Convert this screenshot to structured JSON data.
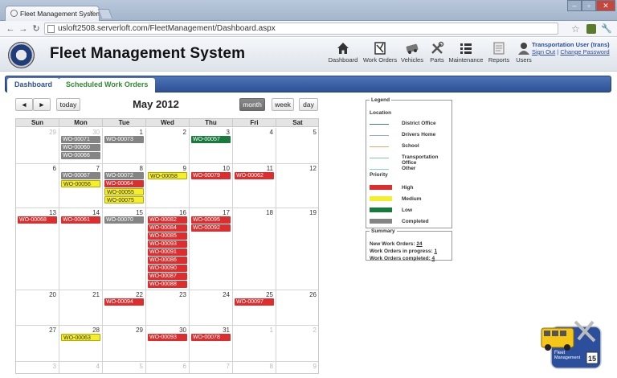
{
  "browser": {
    "tab_title": "Fleet Management System",
    "url": "usloft2508.serverloft.com/FleetManagement/Dashboard.aspx",
    "tab_close": "×"
  },
  "header": {
    "title": "Fleet Management System",
    "nav": [
      {
        "label": "Dashboard",
        "icon": "home-icon"
      },
      {
        "label": "Work Orders",
        "icon": "work-order-icon"
      },
      {
        "label": "Vehicles",
        "icon": "vehicle-icon"
      },
      {
        "label": "Parts",
        "icon": "parts-icon"
      },
      {
        "label": "Maintenance",
        "icon": "maintenance-icon"
      },
      {
        "label": "Reports",
        "icon": "reports-icon"
      },
      {
        "label": "Users",
        "icon": "users-icon"
      }
    ],
    "user": {
      "name": "Transportation User (trans)",
      "signout": "Sign Out",
      "separator": "|",
      "change_password": "Change Password"
    }
  },
  "tabs": [
    {
      "label": "Dashboard",
      "active": true
    },
    {
      "label": "Scheduled Work Orders",
      "active": false
    }
  ],
  "calendar": {
    "title": "May 2012",
    "prev": "◄",
    "next": "►",
    "today": "today",
    "views": [
      {
        "label": "month",
        "active": true
      },
      {
        "label": "week",
        "active": false
      },
      {
        "label": "day",
        "active": false
      }
    ],
    "days": [
      "Sun",
      "Mon",
      "Tue",
      "Wed",
      "Thu",
      "Fri",
      "Sat"
    ],
    "weeks": [
      [
        {
          "d": "29",
          "o": true
        },
        {
          "d": "30",
          "o": true
        },
        {
          "d": "1"
        },
        {
          "d": "2"
        },
        {
          "d": "3"
        },
        {
          "d": "4"
        },
        {
          "d": "5"
        }
      ],
      [
        {
          "d": "6"
        },
        {
          "d": "7"
        },
        {
          "d": "8"
        },
        {
          "d": "9"
        },
        {
          "d": "10"
        },
        {
          "d": "11"
        },
        {
          "d": "12"
        }
      ],
      [
        {
          "d": "13"
        },
        {
          "d": "14"
        },
        {
          "d": "15"
        },
        {
          "d": "16"
        },
        {
          "d": "17"
        },
        {
          "d": "18"
        },
        {
          "d": "19"
        }
      ],
      [
        {
          "d": "20"
        },
        {
          "d": "21"
        },
        {
          "d": "22"
        },
        {
          "d": "23"
        },
        {
          "d": "24"
        },
        {
          "d": "25"
        },
        {
          "d": "26"
        }
      ],
      [
        {
          "d": "27"
        },
        {
          "d": "28"
        },
        {
          "d": "29"
        },
        {
          "d": "30"
        },
        {
          "d": "31"
        },
        {
          "d": "1",
          "o": true
        },
        {
          "d": "2",
          "o": true
        }
      ],
      [
        {
          "d": "3",
          "o": true
        },
        {
          "d": "4",
          "o": true
        },
        {
          "d": "5",
          "o": true
        },
        {
          "d": "6",
          "o": true
        },
        {
          "d": "7",
          "o": true
        },
        {
          "d": "8",
          "o": true
        },
        {
          "d": "9",
          "o": true
        }
      ]
    ],
    "events": [
      {
        "w": 0,
        "d": 1,
        "label": "WO-00071",
        "p": "completed"
      },
      {
        "w": 0,
        "d": 1,
        "label": "WO-00060",
        "p": "completed"
      },
      {
        "w": 0,
        "d": 1,
        "label": "WO-00066",
        "p": "completed"
      },
      {
        "w": 0,
        "d": 2,
        "label": "WO-00073",
        "p": "completed"
      },
      {
        "w": 0,
        "d": 4,
        "label": "WO-00057",
        "p": "low"
      },
      {
        "w": 1,
        "d": 1,
        "label": "WO-00067",
        "p": "completed"
      },
      {
        "w": 1,
        "d": 1,
        "label": "WO-00056",
        "p": "medium"
      },
      {
        "w": 1,
        "d": 2,
        "label": "WO-00072",
        "p": "completed"
      },
      {
        "w": 1,
        "d": 2,
        "label": "WO-00064",
        "p": "high"
      },
      {
        "w": 1,
        "d": 2,
        "label": "WO-00055",
        "p": "medium"
      },
      {
        "w": 1,
        "d": 2,
        "label": "WO-00075",
        "p": "medium"
      },
      {
        "w": 1,
        "d": 3,
        "label": "WO-00058",
        "p": "medium"
      },
      {
        "w": 1,
        "d": 4,
        "label": "WO-00079",
        "p": "high"
      },
      {
        "w": 1,
        "d": 5,
        "label": "WO-00062",
        "p": "high"
      },
      {
        "w": 2,
        "d": 0,
        "label": "WO-00068",
        "p": "high"
      },
      {
        "w": 2,
        "d": 1,
        "label": "WO-00061",
        "p": "high"
      },
      {
        "w": 2,
        "d": 2,
        "label": "WO-00070",
        "p": "completed"
      },
      {
        "w": 2,
        "d": 3,
        "label": "WO-00082",
        "p": "high"
      },
      {
        "w": 2,
        "d": 3,
        "label": "WO-00084",
        "p": "high"
      },
      {
        "w": 2,
        "d": 3,
        "label": "WO-00085",
        "p": "high"
      },
      {
        "w": 2,
        "d": 3,
        "label": "WO-00093",
        "p": "high"
      },
      {
        "w": 2,
        "d": 3,
        "label": "WO-00091",
        "p": "high"
      },
      {
        "w": 2,
        "d": 3,
        "label": "WO-00086",
        "p": "high"
      },
      {
        "w": 2,
        "d": 3,
        "label": "WO-00090",
        "p": "high"
      },
      {
        "w": 2,
        "d": 3,
        "label": "WO-00087",
        "p": "high"
      },
      {
        "w": 2,
        "d": 3,
        "label": "WO-00088",
        "p": "high"
      },
      {
        "w": 2,
        "d": 4,
        "label": "WO-00095",
        "p": "high"
      },
      {
        "w": 2,
        "d": 4,
        "label": "WO-00092",
        "p": "high"
      },
      {
        "w": 3,
        "d": 2,
        "label": "WO-00094",
        "p": "high"
      },
      {
        "w": 3,
        "d": 5,
        "label": "WO-00097",
        "p": "high"
      },
      {
        "w": 4,
        "d": 1,
        "label": "WO-00063",
        "p": "medium"
      },
      {
        "w": 4,
        "d": 3,
        "label": "WO-00093",
        "p": "high"
      },
      {
        "w": 4,
        "d": 4,
        "label": "WO-00078",
        "p": "high"
      }
    ]
  },
  "legend": {
    "title": "Legend",
    "location_title": "Location",
    "locations": [
      {
        "label": "District Office",
        "color": "#4a6fb5"
      },
      {
        "label": "Drivers Home",
        "color": "#9aa8e0"
      },
      {
        "label": "School",
        "color": "#f0a868"
      },
      {
        "label": "Transportation Office",
        "color": "#88c8a0"
      },
      {
        "label": "Other",
        "color": "#7fd0e8"
      }
    ],
    "priority_title": "Priority",
    "priorities": [
      {
        "label": "High",
        "color": "#dc2e2e"
      },
      {
        "label": "Medium",
        "color": "#f3ef2a"
      },
      {
        "label": "Low",
        "color": "#187a3c"
      },
      {
        "label": "Completed",
        "color": "#848484"
      }
    ]
  },
  "summary": {
    "title": "Summary",
    "new_label": "New Work Orders:",
    "new_value": "24",
    "progress_label": "Work Orders in progress:",
    "progress_value": "1",
    "completed_label": "Work Orders completed:",
    "completed_value": "4"
  },
  "corner_logo": {
    "line1": "Fleet",
    "line2": "Management",
    "day": "15"
  }
}
